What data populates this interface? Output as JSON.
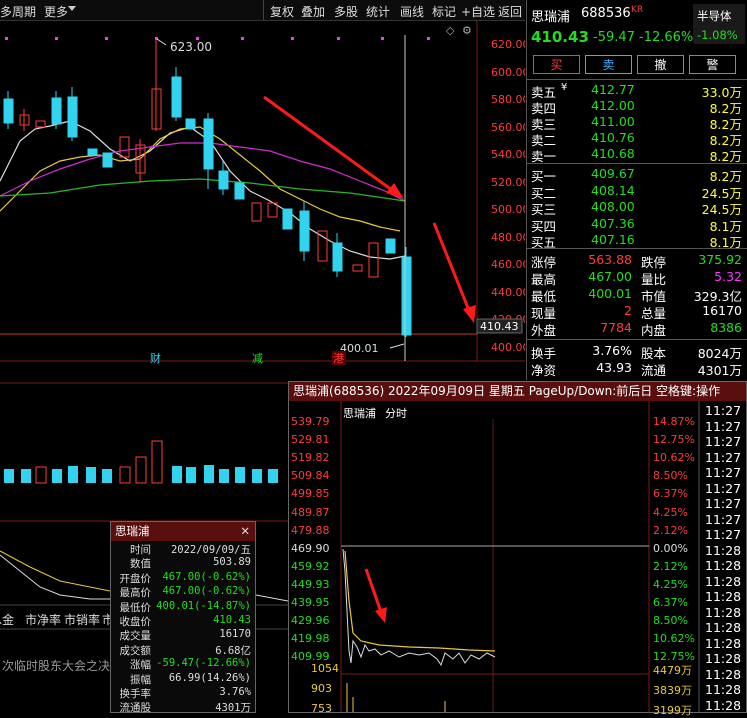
{
  "topbar": {
    "period": "多周期",
    "more": "更多",
    "buttons": [
      "复权",
      "叠加",
      "多股",
      "统计",
      "画线",
      "标记",
      "+自选",
      "返回"
    ]
  },
  "kchart": {
    "price_axis": [
      "620.00",
      "600.00",
      "580.00",
      "560.00",
      "540.00",
      "520.00",
      "500.00",
      "480.00",
      "460.00",
      "440.00",
      "420.00",
      "400.00"
    ],
    "high_label": "623.00",
    "low_label": "400.01",
    "current_price_tag": "410.43",
    "event_markers": [
      "财",
      "减",
      "港"
    ],
    "lower_tabs": [
      "总金",
      "市净率",
      "市销率",
      "市现率"
    ],
    "news_ticker": "次临时股东大会之决"
  },
  "quote": {
    "name": "思瑞浦",
    "code": "688536",
    "market": "KR",
    "sector": "半导体",
    "sector_change": "-1.08%",
    "price": "410.43",
    "change": "-59.47",
    "change_pct": "-12.66%",
    "trade_buttons": [
      "买",
      "卖",
      "撤",
      "警"
    ],
    "asks": [
      {
        "label": "卖五",
        "flag": "¥",
        "price": "412.77",
        "vol": "33.0万"
      },
      {
        "label": "卖四",
        "flag": "",
        "price": "412.00",
        "vol": "8.2万"
      },
      {
        "label": "卖三",
        "flag": "",
        "price": "411.00",
        "vol": "8.2万"
      },
      {
        "label": "卖二",
        "flag": "",
        "price": "410.76",
        "vol": "8.2万"
      },
      {
        "label": "卖一",
        "flag": "",
        "price": "410.68",
        "vol": "8.2万"
      }
    ],
    "bids": [
      {
        "label": "买一",
        "price": "409.67",
        "vol": "8.2万"
      },
      {
        "label": "买二",
        "price": "408.14",
        "vol": "24.5万"
      },
      {
        "label": "买三",
        "price": "408.00",
        "vol": "24.5万"
      },
      {
        "label": "买四",
        "price": "407.36",
        "vol": "8.1万"
      },
      {
        "label": "买五",
        "price": "407.16",
        "vol": "8.1万"
      }
    ],
    "stats": [
      {
        "l1": "涨停",
        "v1": "563.88",
        "l2": "跌停",
        "v2": "375.92"
      },
      {
        "l1": "最高",
        "v1": "467.00",
        "l2": "量比",
        "v2": "5.32"
      },
      {
        "l1": "最低",
        "v1": "400.01",
        "l2": "市值",
        "v2": "329.3亿"
      },
      {
        "l1": "现量",
        "v1": "2",
        "l2": "总量",
        "v2": "16170"
      },
      {
        "l1": "外盘",
        "v1": "7784",
        "l2": "内盘",
        "v2": "8386"
      }
    ],
    "stats2": [
      {
        "l1": "换手",
        "v1": "3.76%",
        "l2": "股本",
        "v2": "8024万"
      },
      {
        "l1": "净资",
        "v1": "43.93",
        "l2": "流通",
        "v2": "4301万"
      }
    ]
  },
  "tooltip": {
    "title": "思瑞浦",
    "rows": [
      {
        "k": "时间",
        "v": "2022/09/09/五"
      },
      {
        "k": "数值",
        "v": "503.89"
      },
      {
        "k": "开盘价",
        "v": "467.00(-0.62%)"
      },
      {
        "k": "最高价",
        "v": "467.00(-0.62%)"
      },
      {
        "k": "最低价",
        "v": "400.01(-14.87%)"
      },
      {
        "k": "收盘价",
        "v": "410.43"
      },
      {
        "k": "成交量",
        "v": "16170"
      },
      {
        "k": "成交额",
        "v": "6.68亿"
      },
      {
        "k": "涨幅",
        "v": "-59.47(-12.66%)"
      },
      {
        "k": "振幅",
        "v": "66.99(14.26%)"
      },
      {
        "k": "换手率",
        "v": "3.76%"
      },
      {
        "k": "流通股",
        "v": "4301万"
      }
    ]
  },
  "intraday": {
    "title": "思瑞浦(688536) 2022年09月09日 星期五 PageUp/Down:前后日 空格键:操作",
    "label": "思瑞浦",
    "label2": "分时",
    "left_axis": [
      "539.79",
      "529.81",
      "519.82",
      "509.84",
      "499.85",
      "489.87",
      "479.88",
      "469.90",
      "459.92",
      "449.93",
      "439.95",
      "429.96",
      "419.98",
      "409.99"
    ],
    "right_axis": [
      "14.87%",
      "12.75%",
      "10.62%",
      "8.50%",
      "6.37%",
      "4.25%",
      "2.12%",
      "0.00%",
      "2.12%",
      "4.25%",
      "6.37%",
      "8.50%",
      "10.62%",
      "12.75%"
    ],
    "vol_left": [
      "1054",
      "903",
      "753"
    ],
    "vol_right": [
      "4479万",
      "3839万",
      "3199万"
    ],
    "times": [
      "11:27",
      "11:27",
      "11:27",
      "11:27",
      "11:27",
      "11:27",
      "11:27",
      "11:27",
      "11:27",
      "11:28",
      "11:28",
      "11:28",
      "11:28",
      "11:28",
      "11:28",
      "11:28",
      "11:28",
      "11:28",
      "11:28",
      "11:28"
    ]
  }
}
